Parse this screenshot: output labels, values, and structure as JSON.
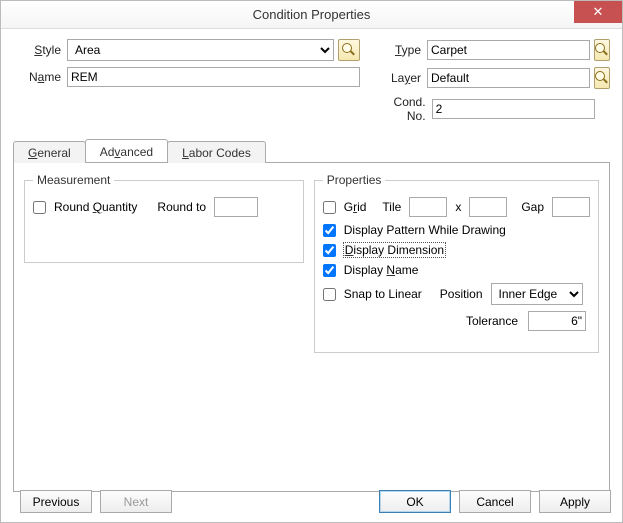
{
  "window": {
    "title": "Condition Properties"
  },
  "fields": {
    "style_label": "Style",
    "style_value": "Area",
    "name_label": "Name",
    "name_value": "REM",
    "type_label": "Type",
    "type_value": "Carpet",
    "layer_label": "Layer",
    "layer_value": "Default",
    "condno_label": "Cond. No.",
    "condno_value": "2"
  },
  "tabs": {
    "general": "General",
    "advanced": "Advanced",
    "labor": "Labor Codes"
  },
  "measurement": {
    "legend": "Measurement",
    "round_qty": "Round Quantity",
    "round_to": "Round to",
    "round_to_value": ""
  },
  "properties": {
    "legend": "Properties",
    "grid": "Grid",
    "tile": "Tile",
    "tile_w": "",
    "x": "x",
    "tile_h": "",
    "gap": "Gap",
    "gap_v": "",
    "disp_pattern": "Display Pattern While Drawing",
    "disp_dim": "Display Dimension",
    "disp_name": "Display Name",
    "snap_linear": "Snap to Linear",
    "position_label": "Position",
    "position_value": "Inner Edge",
    "tolerance_label": "Tolerance",
    "tolerance_value": "6\""
  },
  "buttons": {
    "previous": "Previous",
    "next": "Next",
    "ok": "OK",
    "cancel": "Cancel",
    "apply": "Apply"
  }
}
